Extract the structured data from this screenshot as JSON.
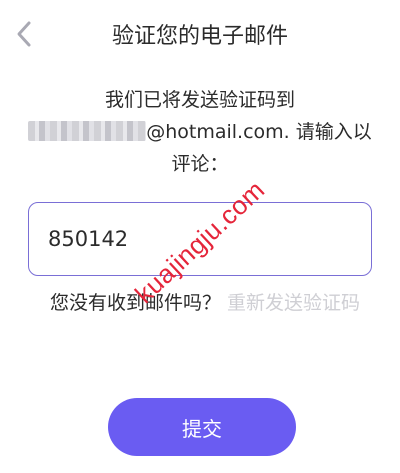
{
  "header": {
    "title": "验证您的电子邮件",
    "back_icon": "chevron-left-icon"
  },
  "instruction": {
    "prefix": "我们已将发送验证码到",
    "email_visible": "@hotmail.com",
    "suffix": ". 请输入以评论："
  },
  "code_input": {
    "value": "850142"
  },
  "resend": {
    "prompt": "您没有收到邮件吗？",
    "link": "重新发送验证码"
  },
  "submit": {
    "label": "提交"
  },
  "watermark": {
    "text": "kuajingju.com"
  },
  "colors": {
    "accent": "#6a5cf2",
    "input_border": "#7a6fd6",
    "muted_link": "#cfcfd4",
    "watermark": "#e5253a"
  }
}
